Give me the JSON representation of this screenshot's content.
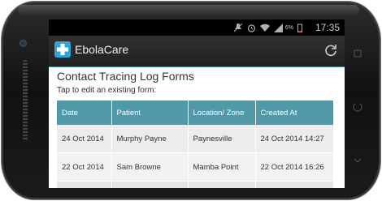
{
  "status_bar": {
    "battery_percent": "6%",
    "time": "17:35",
    "icons": [
      "muted-notifications-icon",
      "alarm-icon",
      "wifi-icon",
      "signal-icon",
      "battery-icon"
    ]
  },
  "action_bar": {
    "app_name": "EbolaCare",
    "app_icon": "medical-cross-icon",
    "refresh_icon": "refresh-icon"
  },
  "page": {
    "title": "Contact Tracing Log Forms",
    "instruction": "Tap to edit an existing form:"
  },
  "table": {
    "columns": [
      "Date",
      "Patient",
      "Location/ Zone",
      "Created At"
    ],
    "rows": [
      {
        "date": "24 Oct 2014",
        "patient": "Murphy Payne",
        "location": "Paynesville",
        "created_at": "24 Oct 2014 14:27"
      },
      {
        "date": "22 Oct 2014",
        "patient": "Sam Browne",
        "location": "Mamba Point",
        "created_at": "22 Oct 2014 16:26"
      }
    ]
  },
  "colors": {
    "header_bg": "#5199a8",
    "app_icon_bg": "#2ea6d3",
    "action_bar_bg": "#262626"
  }
}
